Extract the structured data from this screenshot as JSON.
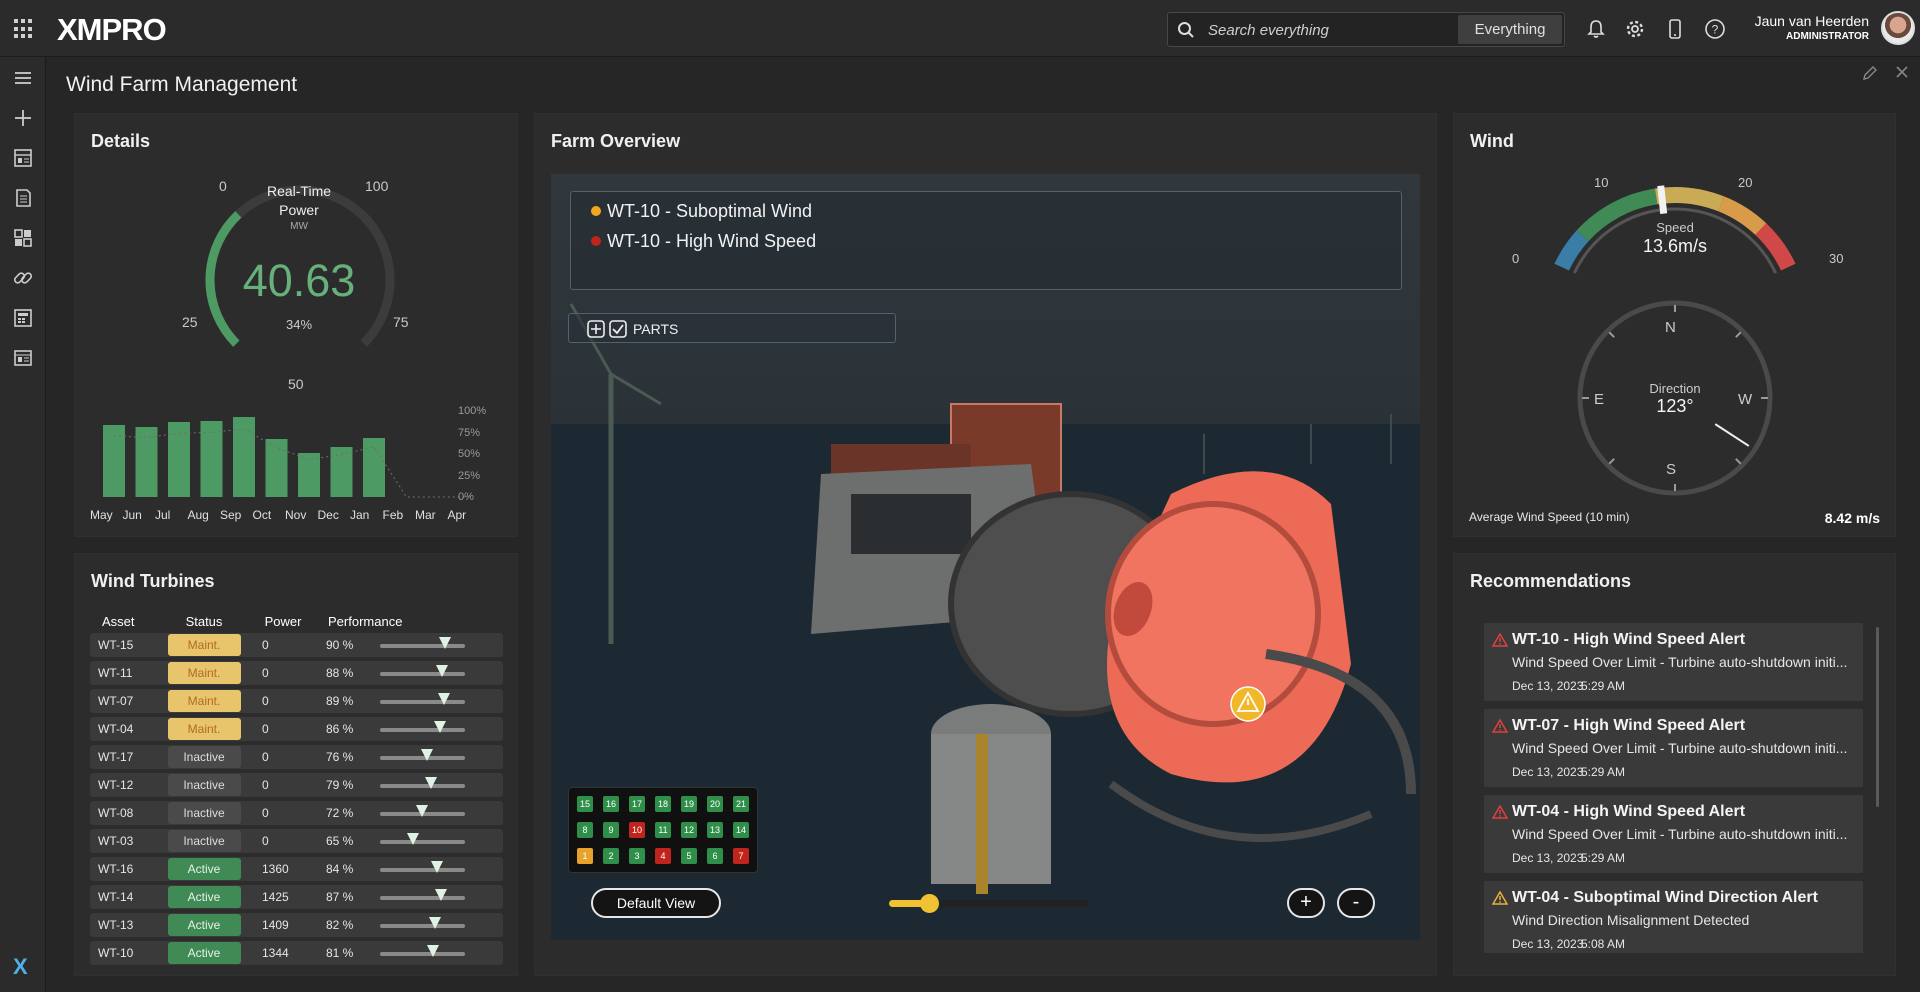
{
  "header": {
    "logo": "XMPRO",
    "search_placeholder": "Search everything",
    "search_scope": "Everything",
    "user_name": "Jaun van Heerden",
    "user_role": "ADMINISTRATOR"
  },
  "page_title": "Wind Farm Management",
  "details": {
    "title": "Details",
    "gauge": {
      "title_line1": "Real-Time",
      "title_line2": "Power",
      "unit": "MW",
      "value": "40.63",
      "percent": "34%",
      "fraction": 0.34,
      "ticks": [
        "0",
        "25",
        "50",
        "75",
        "100"
      ]
    },
    "months": [
      "May",
      "Jun",
      "Jul",
      "Aug",
      "Sep",
      "Oct",
      "Nov",
      "Dec",
      "Jan",
      "Feb",
      "Mar",
      "Apr"
    ],
    "bar_values": [
      72,
      70,
      75,
      76,
      80,
      58,
      44,
      50,
      59,
      0,
      0,
      0
    ],
    "pct_labels": [
      "100%",
      "75%",
      "50%",
      "25%",
      "0%"
    ]
  },
  "wind_turbines": {
    "title": "Wind Turbines",
    "columns": [
      "Asset",
      "Status",
      "Power",
      "Performance"
    ],
    "rows": [
      {
        "asset": "WT-15",
        "status": "Maint.",
        "kind": "maint",
        "power": "0",
        "perf": "90 %",
        "p": 90
      },
      {
        "asset": "WT-11",
        "status": "Maint.",
        "kind": "maint",
        "power": "0",
        "perf": "88 %",
        "p": 88
      },
      {
        "asset": "WT-07",
        "status": "Maint.",
        "kind": "maint",
        "power": "0",
        "perf": "89 %",
        "p": 89
      },
      {
        "asset": "WT-04",
        "status": "Maint.",
        "kind": "maint",
        "power": "0",
        "perf": "86 %",
        "p": 86
      },
      {
        "asset": "WT-17",
        "status": "Inactive",
        "kind": "inactive",
        "power": "0",
        "perf": "76 %",
        "p": 76
      },
      {
        "asset": "WT-12",
        "status": "Inactive",
        "kind": "inactive",
        "power": "0",
        "perf": "79 %",
        "p": 79
      },
      {
        "asset": "WT-08",
        "status": "Inactive",
        "kind": "inactive",
        "power": "0",
        "perf": "72 %",
        "p": 72
      },
      {
        "asset": "WT-03",
        "status": "Inactive",
        "kind": "inactive",
        "power": "0",
        "perf": "65 %",
        "p": 65
      },
      {
        "asset": "WT-16",
        "status": "Active",
        "kind": "active",
        "power": "1360",
        "perf": "84 %",
        "p": 84
      },
      {
        "asset": "WT-14",
        "status": "Active",
        "kind": "active",
        "power": "1425",
        "perf": "87 %",
        "p": 87
      },
      {
        "asset": "WT-13",
        "status": "Active",
        "kind": "active",
        "power": "1409",
        "perf": "82 %",
        "p": 82
      },
      {
        "asset": "WT-10",
        "status": "Active",
        "kind": "active",
        "power": "1344",
        "perf": "81 %",
        "p": 81
      }
    ]
  },
  "farm_overview": {
    "title": "Farm Overview",
    "alerts": [
      {
        "text": "WT-10 - Suboptimal Wind",
        "color": "#f0a81c"
      },
      {
        "text": "WT-10 - High Wind Speed",
        "color": "#c0251d"
      }
    ],
    "parts_label": "PARTS",
    "turbine_grid": [
      {
        "n": "15",
        "c": "#2f8f4a"
      },
      {
        "n": "16",
        "c": "#2f8f4a"
      },
      {
        "n": "17",
        "c": "#2f8f4a"
      },
      {
        "n": "18",
        "c": "#2f8f4a"
      },
      {
        "n": "19",
        "c": "#2f8f4a"
      },
      {
        "n": "20",
        "c": "#2f8f4a"
      },
      {
        "n": "21",
        "c": "#2f8f4a"
      },
      {
        "n": "8",
        "c": "#2f8f4a"
      },
      {
        "n": "9",
        "c": "#2f8f4a"
      },
      {
        "n": "10",
        "c": "#c0251d"
      },
      {
        "n": "11",
        "c": "#2f8f4a"
      },
      {
        "n": "12",
        "c": "#2f8f4a"
      },
      {
        "n": "13",
        "c": "#2f8f4a"
      },
      {
        "n": "14",
        "c": "#2f8f4a"
      },
      {
        "n": "1",
        "c": "#e8a22c"
      },
      {
        "n": "2",
        "c": "#2f8f4a"
      },
      {
        "n": "3",
        "c": "#2f8f4a"
      },
      {
        "n": "4",
        "c": "#c0251d"
      },
      {
        "n": "5",
        "c": "#2f8f4a"
      },
      {
        "n": "6",
        "c": "#2f8f4a"
      },
      {
        "n": "7",
        "c": "#c0251d"
      }
    ],
    "default_view_label": "Default View",
    "slider_level": 0.2,
    "zoom_in": "+",
    "zoom_out": "-"
  },
  "wind": {
    "title": "Wind",
    "speed_label": "Speed",
    "speed_value": "13.6m/s",
    "speed_ticks": [
      "0",
      "10",
      "20",
      "30"
    ],
    "speed": 13.6,
    "direction_label": "Direction",
    "direction_value": "123°",
    "direction_deg": 123,
    "compass": [
      "N",
      "E",
      "W",
      "S"
    ],
    "avg_label": "Average Wind Speed (10 min)",
    "avg_value": "8.42 m/s"
  },
  "recommendations": {
    "title": "Recommendations",
    "items": [
      {
        "title": "WT-10 - High Wind Speed Alert",
        "desc": "Wind Speed Over Limit - Turbine auto-shutdown initi...",
        "date": "Dec 13, 2023",
        "time": "5:29 AM",
        "level": "critical"
      },
      {
        "title": "WT-07 - High Wind Speed Alert",
        "desc": "Wind Speed Over Limit - Turbine auto-shutdown initi...",
        "date": "Dec 13, 2023",
        "time": "5:29 AM",
        "level": "critical"
      },
      {
        "title": "WT-04 - High Wind Speed Alert",
        "desc": "Wind Speed Over Limit - Turbine auto-shutdown initi...",
        "date": "Dec 13, 2023",
        "time": "5:29 AM",
        "level": "critical"
      },
      {
        "title": "WT-04 - Suboptimal Wind Direction Alert",
        "desc": "Wind Direction Misalignment Detected",
        "date": "Dec 13, 2023",
        "time": "5:08 AM",
        "level": "warning"
      }
    ]
  },
  "colors": {
    "accent": "#4fb0e6",
    "green": "#3f8a55",
    "maint": "#e8c56b",
    "critical": "#e04040",
    "warning": "#e8b23a"
  }
}
